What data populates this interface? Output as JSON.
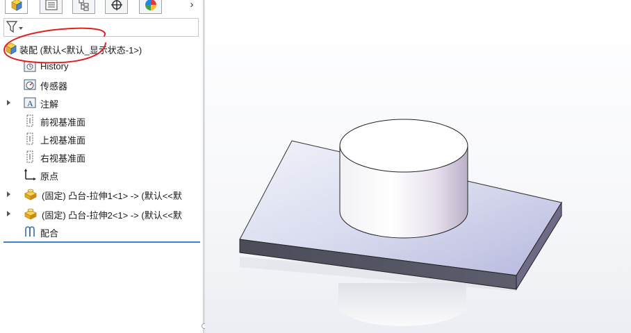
{
  "tabs": [
    {
      "name": "feature-manager-tab",
      "icon": "assembly-cube-icon",
      "active": true
    },
    {
      "name": "property-manager-tab",
      "icon": "property-list-icon",
      "active": false
    },
    {
      "name": "configuration-manager-tab",
      "icon": "configuration-icon",
      "active": false
    },
    {
      "name": "dimxpert-tab",
      "icon": "crosshair-icon",
      "active": false
    },
    {
      "name": "display-manager-tab",
      "icon": "color-wheel-icon",
      "active": false
    }
  ],
  "chevron": "›",
  "filter": {
    "icon": "filter-funnel-icon"
  },
  "tree": {
    "root": {
      "label": "装配  (默认<默认_显示状态-1>)",
      "icon": "assembly-icon"
    },
    "items": [
      {
        "label": "History",
        "icon": "history-icon",
        "expandable": false
      },
      {
        "label": "传感器",
        "icon": "sensor-icon",
        "expandable": false
      },
      {
        "label": "注解",
        "icon": "annotation-icon",
        "expandable": true
      },
      {
        "label": "前视基准面",
        "icon": "plane-icon",
        "expandable": false
      },
      {
        "label": "上视基准面",
        "icon": "plane-icon",
        "expandable": false
      },
      {
        "label": "右视基准面",
        "icon": "plane-icon",
        "expandable": false
      },
      {
        "label": "原点",
        "icon": "origin-icon",
        "expandable": false
      },
      {
        "label": "(固定) 凸台-拉伸1<1> -> (默认<<默",
        "icon": "part-icon",
        "expandable": true
      },
      {
        "label": "(固定) 凸台-拉伸2<1> -> (默认<<默",
        "icon": "part-icon",
        "expandable": true
      },
      {
        "label": "配合",
        "icon": "mate-icon",
        "expandable": false
      }
    ]
  },
  "colors": {
    "accent": "#3f7fc4",
    "annotation": "#e02020",
    "part_yellow": "#f2c23a"
  }
}
